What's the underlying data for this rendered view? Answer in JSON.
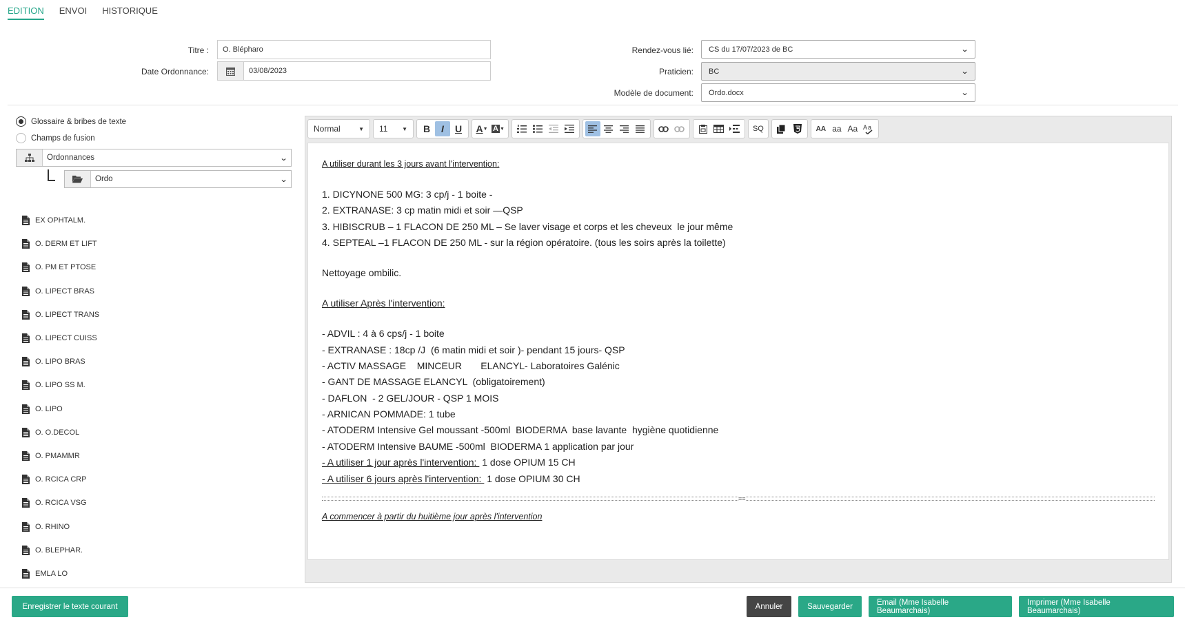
{
  "tabs": {
    "edition": "EDITION",
    "envoi": "ENVOI",
    "historique": "HISTORIQUE"
  },
  "form": {
    "titre_label": "Titre :",
    "titre_value": "O. Blépharo",
    "date_label": "Date Ordonnance:",
    "date_value": "03/08/2023",
    "rdv_label": "Rendez-vous lié:",
    "rdv_value": "CS du 17/07/2023 de BC",
    "praticien_label": "Praticien:",
    "praticien_value": "BC",
    "modele_label": "Modèle de document:",
    "modele_value": "Ordo.docx"
  },
  "sidebar": {
    "radio_glossaire": "Glossaire & bribes de texte",
    "radio_champs": "Champs de fusion",
    "select_category": "Ordonnances",
    "select_folder": "Ordo",
    "items": [
      "EX OPHTALM.",
      "O. DERM ET LIFT",
      "O. PM ET PTOSE",
      "O. LIPECT BRAS",
      "O. LIPECT TRANS",
      "O. LIPECT CUISS",
      "O. LIPO BRAS",
      "O. LIPO SS M.",
      "O. LIPO",
      "O. O.DECOL",
      "O. PMAMMR",
      "O. RCICA CRP",
      "O. RCICA VSG",
      "O. RHINO",
      "O. BLEPHAR.",
      "EMLA LO"
    ]
  },
  "toolbar": {
    "style": "Normal",
    "size": "11",
    "bold": "B",
    "italic": "I",
    "underline": "U",
    "sq": "SQ",
    "case_upper": "AA",
    "case_lower": "aa",
    "case_title": "Aa"
  },
  "document": {
    "l1": "A utiliser durant les 3 jours avant l'intervention:",
    "l2": "1. DICYNONE 500 MG: 3 cp/j - 1 boite -",
    "l3": "2. EXTRANASE: 3 cp matin midi et soir —QSP",
    "l4": "3. HIBISCRUB – 1 FLACON DE 250 ML – Se laver visage et corps et les cheveux  le jour même",
    "l5": "4. SEPTEAL –1 FLACON DE 250 ML - sur la région opératoire. (tous les soirs après la toilette)",
    "l6": "Nettoyage ombilic.",
    "l7": "A utiliser Après l'intervention:",
    "l8": "- ADVIL : 4 à 6 cps/j - 1 boite",
    "l9": "- EXTRANASE : 18cp /J  (6 matin midi et soir )- pendant 15 jours- QSP",
    "l10": "- ACTIV MASSAGE    MINCEUR       ELANCYL- Laboratoires Galénic",
    "l11": "- GANT DE MASSAGE ELANCYL  (obligatoirement)",
    "l12": "- DAFLON  - 2 GEL/JOUR - QSP 1 MOIS",
    "l13": "- ARNICAN POMMADE: 1 tube",
    "l14": "- ATODERM Intensive Gel moussant -500ml  BIODERMA  base lavante  hygiène quotidienne",
    "l15": "- ATODERM Intensive BAUME -500ml  BIODERMA 1 application par jour",
    "l16a": "- A utiliser 1 jour après l'intervention: ",
    "l16b": " 1 dose OPIUM 15 CH",
    "l17a": "- A utiliser 6 jours après l'intervention: ",
    "l17b": " 1 dose OPIUM 30 CH",
    "l18": "A commencer à partir du huitième jour après l'intervention"
  },
  "footer": {
    "enregistrer": "Enregistrer le texte courant",
    "annuler": "Annuler",
    "sauvegarder": "Sauvegarder",
    "email": "Email (Mme Isabelle Beaumarchais)",
    "imprimer": "Imprimer (Mme Isabelle Beaumarchais)"
  },
  "colors": {
    "accent": "#2aa887",
    "dark_button": "#454545",
    "active_toolbar": "#9fc0e3"
  },
  "icons": {
    "calendar": "calendar-icon",
    "sitemap": "sitemap-icon",
    "folder": "folder-open-icon",
    "doc": "file-text-icon"
  }
}
